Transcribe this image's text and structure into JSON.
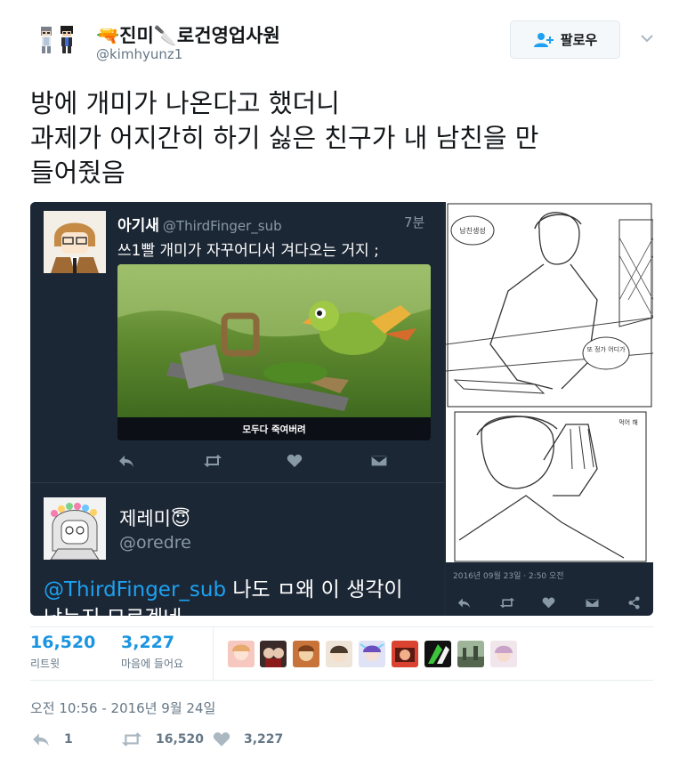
{
  "author": {
    "name": "🔫진미🔪로건영업사원",
    "handle": "@kimhyunz1"
  },
  "follow_button": {
    "label": "팔로우"
  },
  "tweet": {
    "lines": [
      "방에 개미가 나온다고 했더니",
      "과제가 어지간히 하기 싫은 친구가 내 남친을  만",
      "들어줬음"
    ]
  },
  "quoted1": {
    "name": "아기새",
    "handle": "@ThirdFinger_sub",
    "time": "7분",
    "text": "쓰1빨 개미가 자꾸어디서 겨다오는 거지 ;",
    "video_caption": "모두다 죽여버려"
  },
  "quoted2": {
    "name": "제레미😇",
    "handle": "@oredre",
    "mention": "@ThirdFinger_sub",
    "text": " 나도 ㅁ왜 이 생각이",
    "text_line2": "났는지 모르겠네"
  },
  "comic": {
    "date": "2016년 09월 23일 · 2:50 오전",
    "bubble1": "남친생성",
    "bubble2": "또 정가\n어디가",
    "bubble3": "먹어 해"
  },
  "stats": {
    "retweets": "16,520",
    "retweets_label": "리트윗",
    "likes": "3,227",
    "likes_label": "마음에 들어요"
  },
  "timestamp": "오전 10:56 - 2016년 9월 24일",
  "actions": {
    "reply_count": "1",
    "retweet_count": "16,520",
    "like_count": "3,227"
  },
  "colors": {
    "link_blue": "#1b95e0",
    "dark_bg": "#1c2735",
    "muted": "#657786"
  }
}
